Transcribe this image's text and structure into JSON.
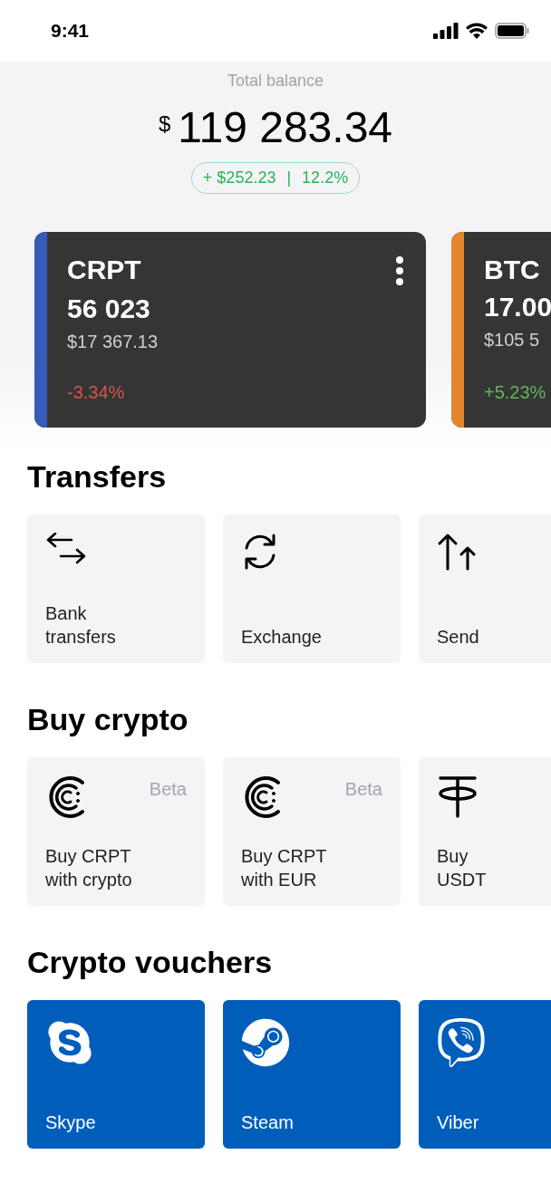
{
  "status_bar": {
    "time": "9:41"
  },
  "balance": {
    "label": "Total balance",
    "currency": "$",
    "amount": "119 283.34",
    "change": "+ $252.23",
    "separator": "|",
    "percent": "12.2%"
  },
  "coins": [
    {
      "symbol": "CRPT",
      "amount": "56 023",
      "value": "$17 367.13",
      "change": "-3.34%",
      "negative": true,
      "color": "#345cb8",
      "menu": true
    },
    {
      "symbol": "BTC",
      "amount": "17.00",
      "value": "$105 5",
      "change": "+5.23%",
      "negative": false,
      "color": "#e5862f",
      "menu": false
    }
  ],
  "sections": [
    {
      "title": "Transfers",
      "kind": "action",
      "items": [
        {
          "label": "Bank\ntransfers"
        },
        {
          "label": "Exchange"
        },
        {
          "label": "Send"
        }
      ]
    },
    {
      "title": "Buy crypto",
      "kind": "action",
      "items": [
        {
          "label": "Buy CRPT\nwith crypto",
          "badge": "Beta"
        },
        {
          "label": "Buy CRPT\nwith EUR",
          "badge": "Beta"
        },
        {
          "label": "Buy\nUSDT"
        }
      ]
    },
    {
      "title": "Crypto vouchers",
      "kind": "voucher",
      "items": [
        {
          "label": "Skype"
        },
        {
          "label": "Steam"
        },
        {
          "label": "Viber"
        }
      ]
    }
  ]
}
